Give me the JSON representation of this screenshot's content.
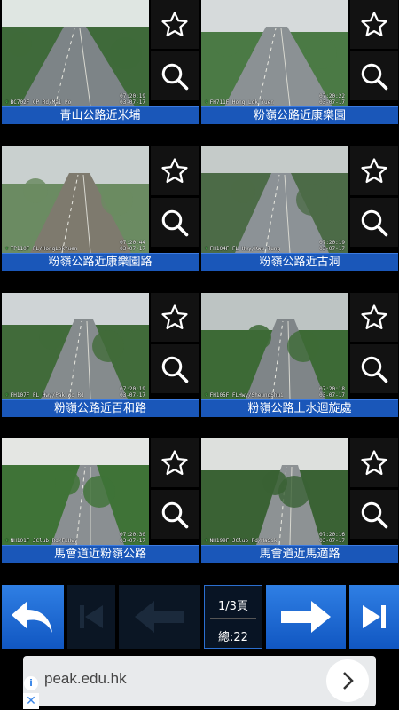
{
  "cameras": [
    {
      "label": "青山公路近米埔",
      "cam_id": "BC702F CP Rd/Mai Po",
      "time": "07:20:19",
      "date": "03-07-17"
    },
    {
      "label": "粉嶺公路近康樂園",
      "cam_id": "FH711F Hong Lok Yuen",
      "time": "07:20:22",
      "date": "03-07-17"
    },
    {
      "label": "粉嶺公路近康樂園路",
      "cam_id": "TP110F FL/HongLokYuen",
      "time": "07:20:44",
      "date": "03-07-17"
    },
    {
      "label": "粉嶺公路近古洞",
      "cam_id": "FH104F FL Hwy/Kwu Tung",
      "time": "07:20:19",
      "date": "03-07-17"
    },
    {
      "label": "粉嶺公路近百和路",
      "cam_id": "FH107F FL Hwy/Pak Wo Rd",
      "time": "07:20:19",
      "date": "03-07-17"
    },
    {
      "label": "粉嶺公路上水迴旋處",
      "cam_id": "FH105F FLHwy/SheungShui",
      "time": "07:20:18",
      "date": "03-07-17"
    },
    {
      "label": "馬會道近粉嶺公路",
      "cam_id": "NH101F JClub Rd/FLHwy",
      "time": "07:20:30",
      "date": "03-07-17"
    },
    {
      "label": "馬會道近馬適路",
      "cam_id": "NH199F JClub Rd/MaSik",
      "time": "07:20:16",
      "date": "03-07-17"
    }
  ],
  "pager": {
    "page": "1/3頁",
    "total": "總:22"
  },
  "icons": {
    "favorite": "star-outline-icon",
    "zoom": "magnifier-icon",
    "back": "undo-arrow-icon",
    "first": "skip-to-start-icon",
    "prev": "arrow-left-icon",
    "next": "arrow-right-icon",
    "last": "skip-to-end-icon"
  },
  "ad": {
    "text": "peak.edu.hk",
    "info": "i",
    "close": "✕"
  },
  "colors": {
    "label_bg": "#1a57b9",
    "button_blue": "#1f6fd8",
    "accent_dim": "#0b1624"
  }
}
